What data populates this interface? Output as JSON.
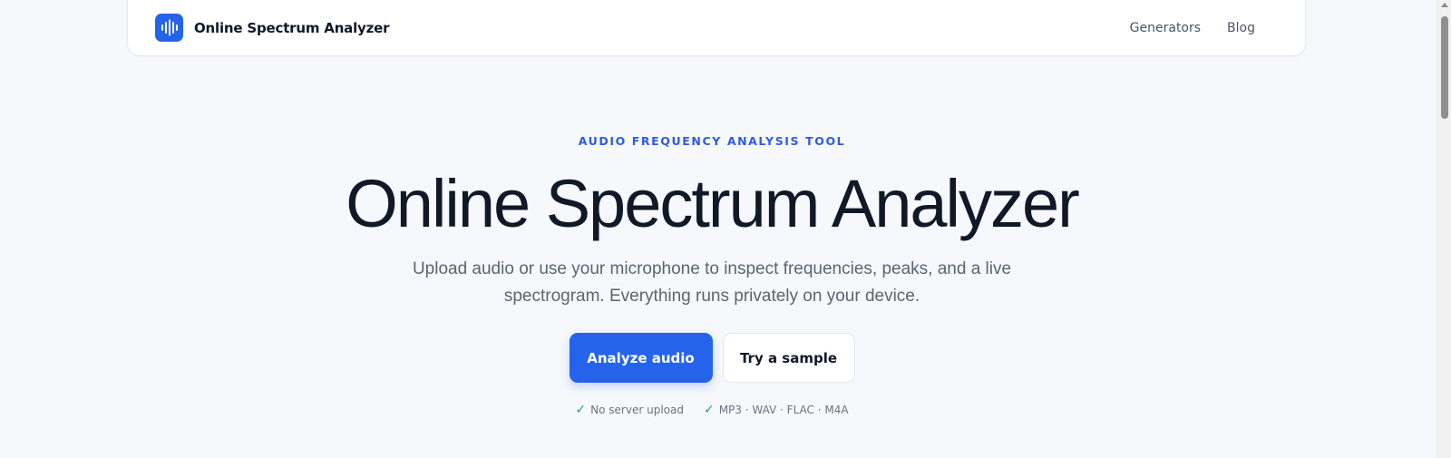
{
  "nav": {
    "brand": "Online Spectrum Analyzer",
    "links": [
      "Generators",
      "Blog"
    ]
  },
  "hero": {
    "eyebrow": "AUDIO FREQUENCY ANALYSIS TOOL",
    "title": "Online Spectrum Analyzer",
    "subtitle": "Upload audio or use your microphone to inspect frequencies, peaks, and a live spectrogram. Everything runs privately on your device.",
    "primary_button": "Analyze audio",
    "secondary_button": "Try a sample",
    "features": [
      "No server upload",
      "MP3 · WAV · FLAC · M4A"
    ],
    "check_glyph": "✓"
  },
  "colors": {
    "accent": "#2563eb",
    "eyebrow": "#2d5be3",
    "check": "#22a55a",
    "background": "#f6f8fb"
  },
  "icons": {
    "logo": "waveform-icon",
    "feature_check": "check-icon"
  }
}
